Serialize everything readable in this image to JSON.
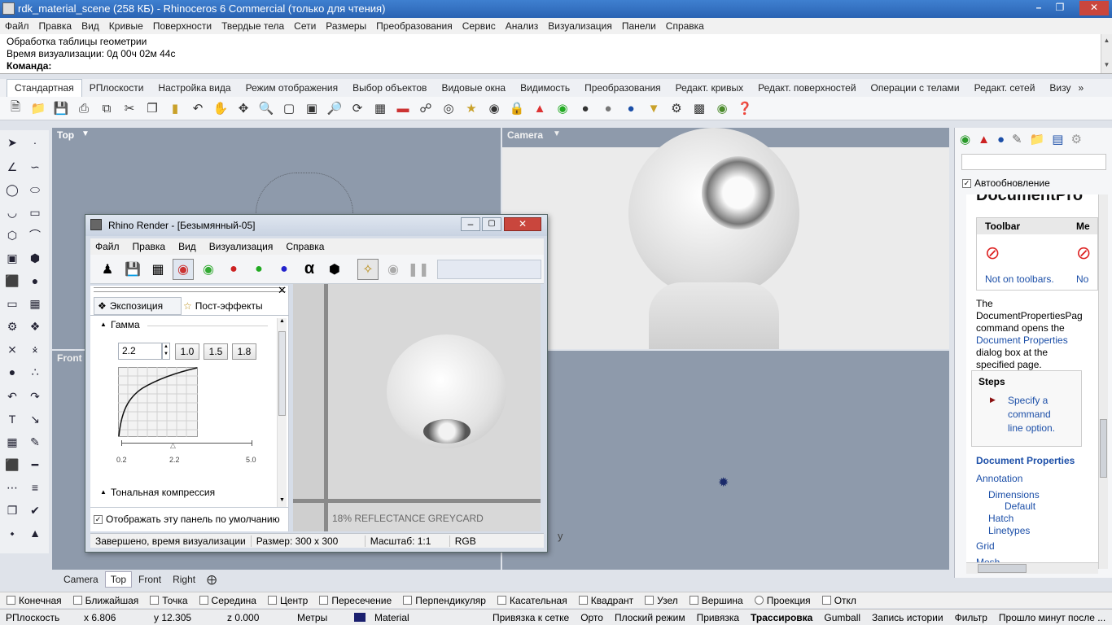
{
  "app": {
    "title": "rdk_material_scene (258 КБ) - Rhinoceros 6 Commercial (только для чтения)"
  },
  "menu": [
    "Файл",
    "Правка",
    "Вид",
    "Кривые",
    "Поверхности",
    "Твердые тела",
    "Сети",
    "Размеры",
    "Преобразования",
    "Сервис",
    "Анализ",
    "Визуализация",
    "Панели",
    "Справка"
  ],
  "command_history": {
    "line1": "Обработка таблицы геометрии",
    "line2": "Время визуализации: 0д 00ч 02м 44с",
    "prompt": "Команда:"
  },
  "tabs": [
    "Стандартная",
    "РПлоскости",
    "Настройка вида",
    "Режим отображения",
    "Выбор объектов",
    "Видовые окна",
    "Видимость",
    "Преобразования",
    "Редакт. кривых",
    "Редакт. поверхностей",
    "Операции с телами",
    "Редакт. сетей",
    "Визу"
  ],
  "viewports": {
    "top_label": "Top",
    "camera_label": "Camera",
    "front_label": "Front",
    "right_axis": "y"
  },
  "view_tabs": [
    "Camera",
    "Top",
    "Front",
    "Right"
  ],
  "render_window": {
    "title": "Rhino Render - [Безымянный-05]",
    "menu": [
      "Файл",
      "Правка",
      "Вид",
      "Визуализация",
      "Справка"
    ],
    "panel_tabs": {
      "exposure": "Экспозиция",
      "post": "Пост-эффекты"
    },
    "gamma_header": "Гамма",
    "gamma_value": "2.2",
    "gamma_presets": [
      "1.0",
      "1.5",
      "1.8"
    ],
    "slider_min": "0.2",
    "slider_mid": "2.2",
    "slider_max": "5.0",
    "tonal_header": "Тональная компрессия",
    "default_checkbox": "Отображать эту панель по умолчанию",
    "greycard": "18% REFLECTANCE GREYCARD",
    "status": [
      "Завершено, время визуализации",
      "Размер: 300 x 300",
      "Масштаб: 1:1",
      "RGB"
    ]
  },
  "right_panel": {
    "auto_update": "Автообновление",
    "doc_title": "DocumentPro",
    "toolbar_col": "Toolbar",
    "menu_col": "Me",
    "not_on_toolbars": "Not on toolbars.",
    "no": "No",
    "desc_1": "The",
    "desc_2": "DocumentPropertiesPag",
    "desc_3": "command opens the",
    "desc_link": "Document Properties",
    "desc_4": "dialog box at the",
    "desc_5": "specified page.",
    "steps_title": "Steps",
    "step_1": "Specify a",
    "step_2": "command",
    "step_3": "line option.",
    "doc_props": "Document Properties",
    "links": [
      "Annotation",
      "Dimensions",
      "Default",
      "Hatch",
      "Linetypes",
      "Grid",
      "Mesh"
    ]
  },
  "osnaps": [
    "Конечная",
    "Ближайшая",
    "Точка",
    "Середина",
    "Центр",
    "Пересечение",
    "Перпендикуляр",
    "Касательная",
    "Квадрант",
    "Узел",
    "Вершина",
    "Проекция",
    "Откл"
  ],
  "status_bar": {
    "cplane": "РПлоскость",
    "x": "x 6.806",
    "y": "y 12.305",
    "z": "z 0.000",
    "units": "Метры",
    "layer": "Material",
    "grid_snap": "Привязка к сетке",
    "ortho": "Орто",
    "planar": "Плоский режим",
    "osnap": "Привязка",
    "smarttrack": "Трассировка",
    "gumball": "Gumball",
    "history": "Запись истории",
    "filter": "Фильтр",
    "elapsed": "Прошло минут после ..."
  },
  "colors": {
    "title_bar": "#2a63b3",
    "viewport_bg": "#8e9aab",
    "layer_swatch": "#1a1f6e",
    "link": "#1c4fa8"
  }
}
